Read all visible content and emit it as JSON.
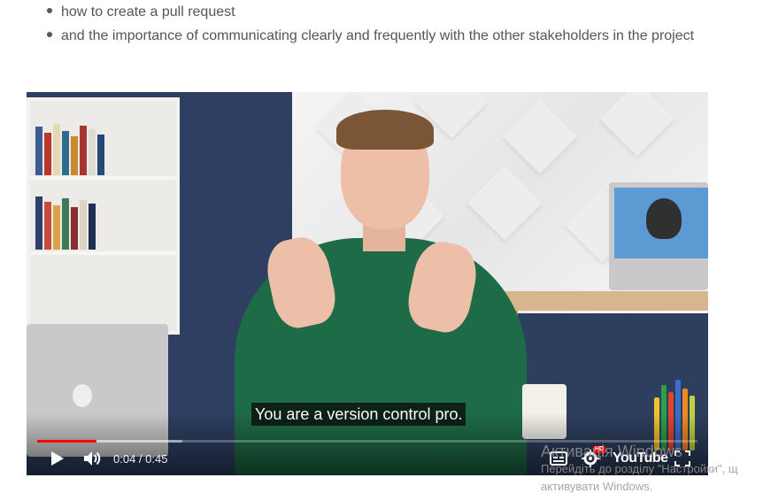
{
  "bullets": [
    "how to create a pull request",
    "and the importance of communicating clearly and frequently with the other stakeholders in the project"
  ],
  "video": {
    "caption": "You are a version control pro.",
    "current_time": "0:04",
    "separator": " / ",
    "duration": "0:45",
    "progress_played": 0.09,
    "progress_loaded": 0.22,
    "hd_badge": "HD",
    "logo_text": "YouTube",
    "icons": {
      "play": "play-icon",
      "volume": "volume-icon",
      "captions": "closed-captions-icon",
      "settings": "gear-icon",
      "fullscreen": "fullscreen-icon"
    },
    "accent_color": "#ff0000"
  },
  "windows_watermark": {
    "title": "Активація Windows",
    "line1": "Перейдіть до розділу \"Настройки\", щ",
    "line2": "активувати Windows."
  }
}
